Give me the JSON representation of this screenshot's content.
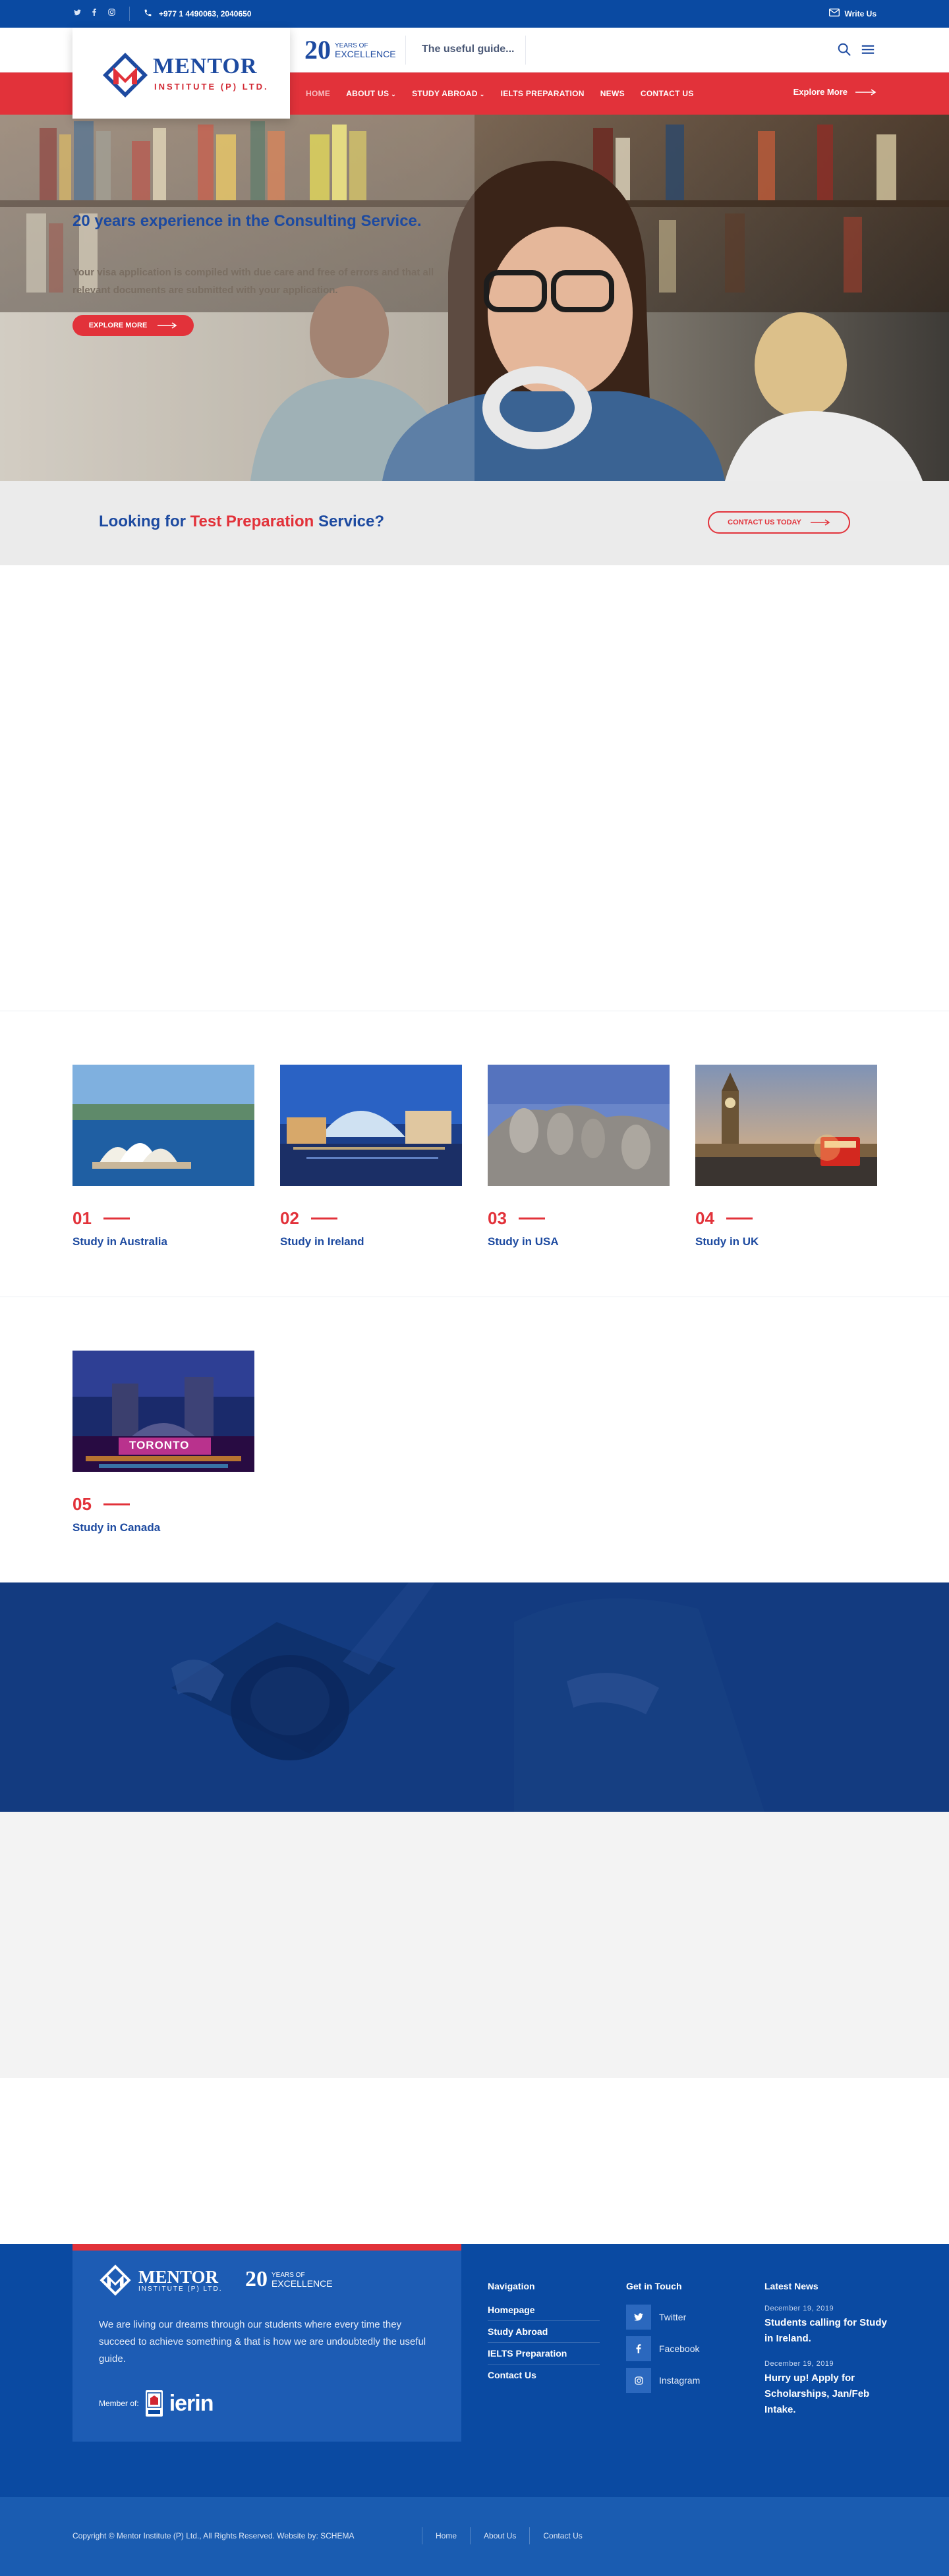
{
  "topbar": {
    "social_icons": [
      "twitter-icon",
      "facebook-icon",
      "instagram-icon"
    ],
    "phone": "+977 1 4490063, 2040650",
    "write_label": "Write Us"
  },
  "brand": {
    "name": "MENTOR",
    "subtitle": "INSTITUTE (P) LTD.",
    "anniversary_number": "20",
    "anniversary_line1": "YEARS OF",
    "anniversary_line2": "EXCELLENCE",
    "tagline": "The useful guide...",
    "colors": {
      "primary_blue": "#0a4aa2",
      "accent_red": "#e2323a"
    }
  },
  "nav": {
    "items": [
      {
        "label": "HOME",
        "active": true
      },
      {
        "label": "ABOUT US",
        "dropdown": true
      },
      {
        "label": "STUDY ABROAD",
        "dropdown": true
      },
      {
        "label": "IELTS PREPARATION"
      },
      {
        "label": "NEWS"
      },
      {
        "label": "CONTACT US"
      }
    ],
    "explore_label": "Explore More"
  },
  "hero": {
    "title": "20 years experience in the Consulting Service.",
    "description": "Your visa application is compiled with due care and free of errors and that all relevant documents are submitted with your application.",
    "button_label": "EXPLORE MORE"
  },
  "cta": {
    "heading_prefix": "Looking for",
    "heading_highlight": "Test Preparation",
    "heading_suffix": "Service?",
    "button_label": "CONTACT US TODAY"
  },
  "destinations": [
    {
      "number": "01",
      "label": "Study in Australia"
    },
    {
      "number": "02",
      "label": "Study in Ireland"
    },
    {
      "number": "03",
      "label": "Study in USA"
    },
    {
      "number": "04",
      "label": "Study in UK"
    },
    {
      "number": "05",
      "label": "Study in Canada",
      "image_text": "TORONTO"
    }
  ],
  "footer": {
    "description": "We are living our dreams through our students where every time they succeed to achieve something & that is how we are undoubtedly the useful guide.",
    "member_label": "Member of:",
    "member_logo_text": "ierin",
    "navigation": {
      "title": "Navigation",
      "links": [
        "Homepage",
        "Study Abroad",
        "IELTS Preparation",
        "Contact Us"
      ]
    },
    "social": {
      "title": "Get in Touch",
      "links": [
        {
          "label": "Twitter",
          "icon": "twitter-icon"
        },
        {
          "label": "Facebook",
          "icon": "facebook-icon"
        },
        {
          "label": "Instagram",
          "icon": "instagram-icon"
        }
      ]
    },
    "news": {
      "title": "Latest News",
      "items": [
        {
          "date": "December 19, 2019",
          "title": "Students calling for Study in Ireland."
        },
        {
          "date": "December 19, 2019",
          "title": "Hurry up! Apply for Scholarships, Jan/Feb Intake."
        }
      ]
    }
  },
  "bottombar": {
    "copyright": "Copyright © Mentor Institute (P) Ltd., All Rights Reserved. Website by: SCHEMA",
    "links": [
      "Home",
      "About Us",
      "Contact Us"
    ]
  }
}
